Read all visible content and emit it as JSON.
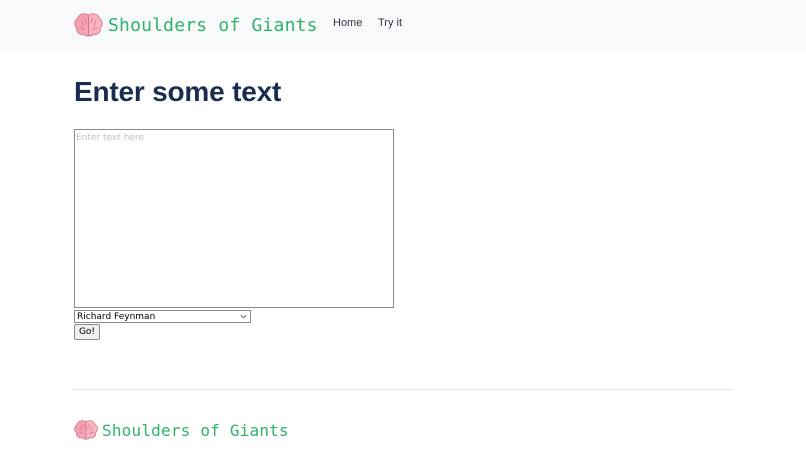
{
  "nav": {
    "brand_name": "Shoulders of Giants",
    "brand_icon": "brain-icon",
    "links": [
      {
        "label": "Home"
      },
      {
        "label": "Try it"
      }
    ]
  },
  "main": {
    "title": "Enter some text",
    "text_input": {
      "value": "",
      "placeholder": "Enter text here"
    },
    "person_select": {
      "selected": "Richard Feynman"
    },
    "go_label": "Go!"
  },
  "footer": {
    "brand_name": "Shoulders of Giants",
    "brand_icon": "brain-icon"
  },
  "colors": {
    "brand_text": "#2fb36b",
    "title": "#1a2d50",
    "navbar_bg": "#f8f9fb",
    "brain_pink": "#f4a3b4"
  }
}
